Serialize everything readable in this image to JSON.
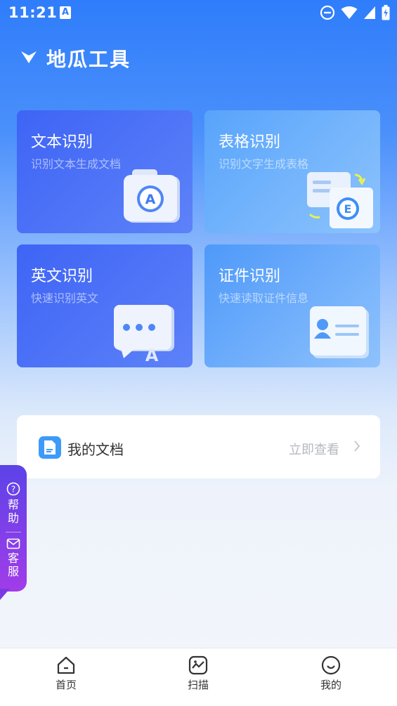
{
  "status_bar": {
    "time": "11:21",
    "notification_icon": "a-notification-icon",
    "icons": [
      "dnd-icon",
      "wifi-icon",
      "signal-icon",
      "battery-charging-icon"
    ]
  },
  "header": {
    "icon": "chevron-down-icon",
    "title": "地瓜工具"
  },
  "cards": [
    {
      "title": "文本识别",
      "subtitle": "识别文本生成文档",
      "icon": "text-recognition-icon"
    },
    {
      "title": "表格识别",
      "subtitle": "识别文字生成表格",
      "icon": "table-recognition-icon"
    },
    {
      "title": "英文识别",
      "subtitle": "快速识别英文",
      "icon": "english-recognition-icon"
    },
    {
      "title": "证件识别",
      "subtitle": "快速读取证件信息",
      "icon": "id-card-recognition-icon"
    }
  ],
  "my_docs": {
    "label": "我的文档",
    "link": "立即查看",
    "icon": "document-icon"
  },
  "side_widget": {
    "help": "帮助",
    "service": "客服"
  },
  "tabbar": {
    "items": [
      {
        "label": "首页",
        "icon": "home-icon"
      },
      {
        "label": "扫描",
        "icon": "scan-icon"
      },
      {
        "label": "我的",
        "icon": "smile-icon"
      }
    ]
  },
  "colors": {
    "primary": "#2f7dfb",
    "card_dark": "#3e64f6",
    "card_light": "#6fb2fc",
    "side_widget": "#7a3fe8"
  }
}
